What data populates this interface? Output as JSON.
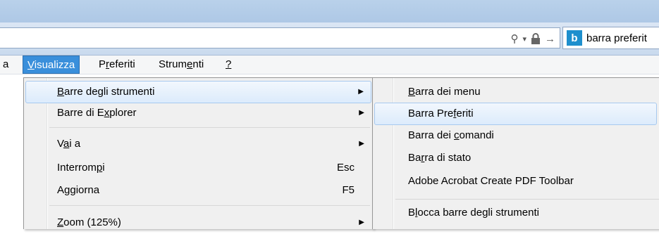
{
  "address": {
    "icons": [
      "search-icon",
      "dropdown-icon",
      "lock-icon",
      "go-arrow-icon"
    ],
    "search_glyph": "⚲",
    "dropdown_glyph": "▾",
    "lock_glyph": "🔒",
    "arrow_glyph": "→"
  },
  "tab": {
    "logo": "b",
    "label": "barra preferit"
  },
  "menubar": {
    "partial": "a",
    "visualizza": "Visualizza",
    "preferiti": "Preferiti",
    "strumenti": "Strumenti",
    "help": "?"
  },
  "view_menu": {
    "items": [
      {
        "label": "Barre degli strumenti",
        "shortcut": "",
        "submenu": true
      },
      {
        "label": "Barre di Explorer",
        "shortcut": "",
        "submenu": true
      },
      {
        "label": "Vai a",
        "shortcut": "",
        "submenu": true
      },
      {
        "label": "Interrompi",
        "shortcut": "Esc",
        "submenu": false
      },
      {
        "label": "Aggiorna",
        "shortcut": "F5",
        "submenu": false
      },
      {
        "label": "Zoom (125%)",
        "shortcut": "",
        "submenu": true
      }
    ]
  },
  "toolbars_submenu": {
    "items": [
      {
        "label": "Barra dei menu"
      },
      {
        "label": "Barra Preferiti"
      },
      {
        "label": "Barra dei comandi"
      },
      {
        "label": "Barra di stato"
      },
      {
        "label": "Adobe Acrobat Create PDF Toolbar"
      },
      {
        "label": "Blocca barre degli strumenti"
      }
    ]
  },
  "colors": {
    "menubar_active": "#3a8fdb",
    "highlight_border": "#a7c9ef",
    "bing": "#1e8fcd"
  }
}
